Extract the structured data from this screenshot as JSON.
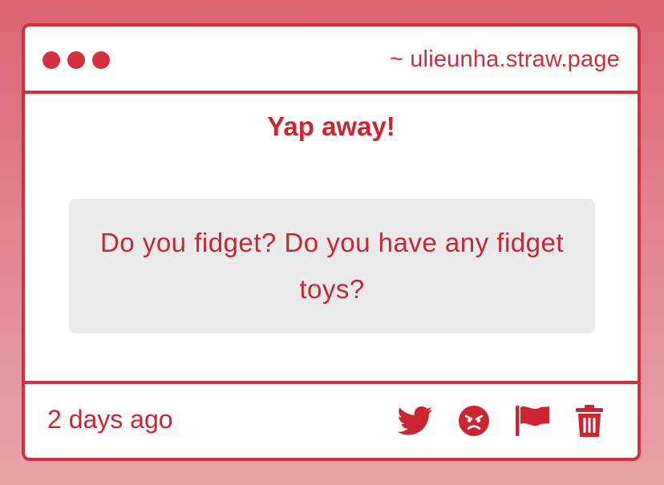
{
  "titlebar": {
    "url": "~ ulieunha.straw.page"
  },
  "content": {
    "heading": "Yap away!",
    "question": "Do you fidget? Do you have any fidget toys?"
  },
  "footer": {
    "timestamp": "2 days ago",
    "icons": [
      "twitter-icon",
      "angry-face-icon",
      "flag-icon",
      "trash-icon"
    ]
  },
  "colors": {
    "accent": "#d3303d",
    "text": "#cc2432",
    "question_bg": "#ecebec",
    "background_top": "#dc6470",
    "background_bottom": "#e9a3ab"
  }
}
